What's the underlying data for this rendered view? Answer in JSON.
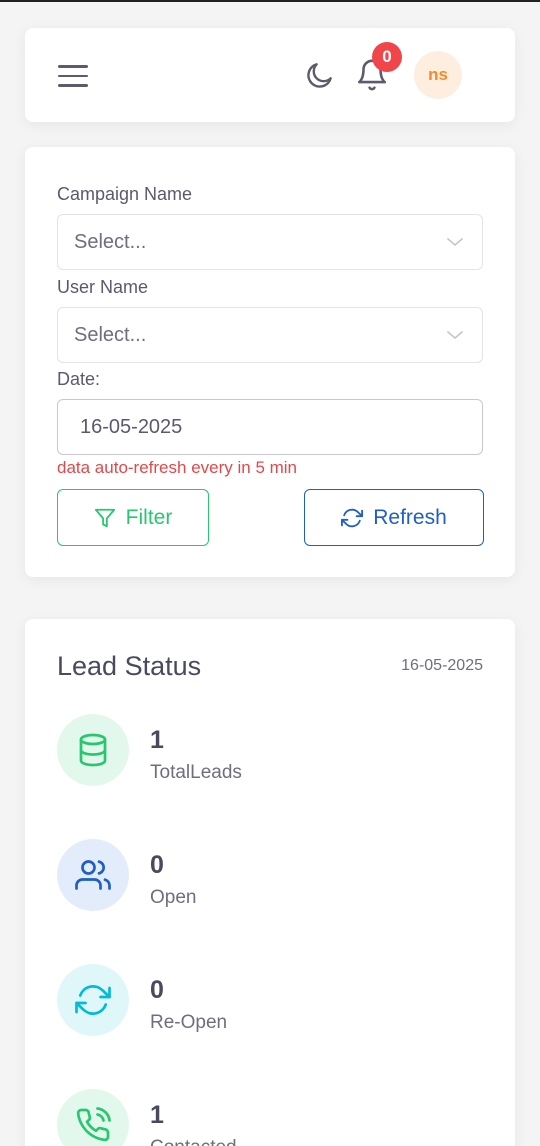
{
  "header": {
    "menu_icon": "hamburger-menu-icon",
    "theme_icon": "moon-icon",
    "notification_icon": "bell-icon",
    "notification_count": "0",
    "avatar_initials": "ns"
  },
  "filters": {
    "campaign_label": "Campaign Name",
    "campaign_placeholder": "Select...",
    "user_label": "User Name",
    "user_placeholder": "Select...",
    "date_label": "Date:",
    "date_value": "16-05-2025",
    "refresh_note": "data auto-refresh every in 5 min",
    "filter_button": "Filter",
    "refresh_button": "Refresh"
  },
  "lead_status": {
    "title": "Lead Status",
    "date": "16-05-2025",
    "items": [
      {
        "count": "1",
        "label": "TotalLeads",
        "icon": "database-icon",
        "color": "#28c76f",
        "bg": "#e3f8ec"
      },
      {
        "count": "0",
        "label": "Open",
        "icon": "users-icon",
        "color": "#1f5fc4",
        "bg": "#e3ecfb"
      },
      {
        "count": "0",
        "label": "Re-Open",
        "icon": "refresh-icon",
        "color": "#00bcd4",
        "bg": "#e0f7fa"
      },
      {
        "count": "1",
        "label": "Contacted",
        "icon": "phone-call-icon",
        "color": "#28c76f",
        "bg": "#e3f8ec"
      }
    ]
  },
  "colors": {
    "primary": "#1f5fc4",
    "success": "#28c76f",
    "danger": "#e0494b",
    "avatar_bg": "#fdeee0",
    "avatar_text": "#f08c2e"
  }
}
